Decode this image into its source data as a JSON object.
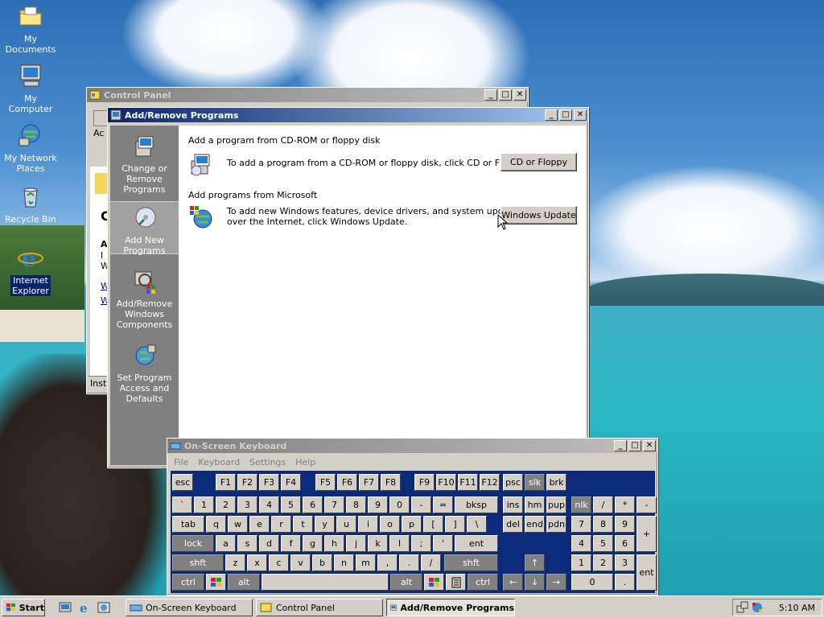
{
  "desktop": {
    "icons": [
      {
        "label": "My Documents",
        "icon": "folder-icon"
      },
      {
        "label": "My Computer",
        "icon": "computer-icon"
      },
      {
        "label": "My Network Places",
        "icon": "network-icon"
      },
      {
        "label": "Recycle Bin",
        "icon": "recycle-bin-icon"
      },
      {
        "label": "Internet Explorer",
        "icon": "internet-explorer-icon"
      }
    ]
  },
  "control_panel": {
    "title": "Control Panel",
    "partial_texts": [
      "Ac",
      "C",
      "A",
      "I",
      "W",
      "W",
      "W",
      "Insta"
    ]
  },
  "add_remove": {
    "title": "Add/Remove Programs",
    "sidebar": [
      {
        "label": "Change or Remove Programs",
        "icon": "change-remove-icon"
      },
      {
        "label": "Add New Programs",
        "icon": "cd-disc-icon"
      },
      {
        "label": "Add/Remove Windows Components",
        "icon": "windows-components-icon"
      },
      {
        "label": "Set Program Access and Defaults",
        "icon": "program-access-icon"
      }
    ],
    "section_cd": {
      "heading": "Add a program from CD-ROM or floppy disk",
      "text": "To add a program from a CD-ROM or floppy disk, click CD or Floppy.",
      "button": "CD or Floppy"
    },
    "section_ms": {
      "heading": "Add programs from Microsoft",
      "text_line1": "To add new Windows features, device drivers, and system updates",
      "text_line2": "over the Internet, click Windows Update.",
      "button": "Windows Update"
    }
  },
  "osk": {
    "title": "On-Screen Keyboard",
    "menu": [
      "File",
      "Keyboard",
      "Settings",
      "Help"
    ],
    "keys": {
      "esc": "esc",
      "f": [
        "F1",
        "F2",
        "F3",
        "F4",
        "F5",
        "F6",
        "F7",
        "F8",
        "F9",
        "F10",
        "F11",
        "F12"
      ],
      "psc": "psc",
      "slk": "slk",
      "brk": "brk",
      "row1": [
        "`",
        "1",
        "2",
        "3",
        "4",
        "5",
        "6",
        "7",
        "8",
        "9",
        "0",
        "-",
        "="
      ],
      "bksp": "bksp",
      "ins": "ins",
      "hm": "hm",
      "pup": "pup",
      "nlk": "nlk",
      "numdiv": "/",
      "nummul": "*",
      "numsub": "-",
      "tab": "tab",
      "row2": [
        "q",
        "w",
        "e",
        "r",
        "t",
        "y",
        "u",
        "i",
        "o",
        "p",
        "[",
        "]",
        "\\"
      ],
      "del": "del",
      "end": "end",
      "pdn": "pdn",
      "num789": [
        "7",
        "8",
        "9"
      ],
      "numadd": "+",
      "lock": "lock",
      "row3": [
        "a",
        "s",
        "d",
        "f",
        "g",
        "h",
        "j",
        "k",
        "l",
        ";",
        "'"
      ],
      "ent": "ent",
      "num456": [
        "4",
        "5",
        "6"
      ],
      "shft": "shft",
      "row4": [
        "z",
        "x",
        "c",
        "v",
        "b",
        "n",
        "m",
        ",",
        ".",
        "/"
      ],
      "up": "↑",
      "num123": [
        "1",
        "2",
        "3"
      ],
      "ctrl": "ctrl",
      "alt": "alt",
      "left": "←",
      "down": "↓",
      "right": "→",
      "num0": "0",
      "numdot": ".",
      "nument": "ent"
    }
  },
  "taskbar": {
    "start": "Start",
    "tasks": [
      "On-Screen Keyboard",
      "Control Panel",
      "Add/Remove Programs"
    ],
    "clock": "5:10 AM"
  }
}
